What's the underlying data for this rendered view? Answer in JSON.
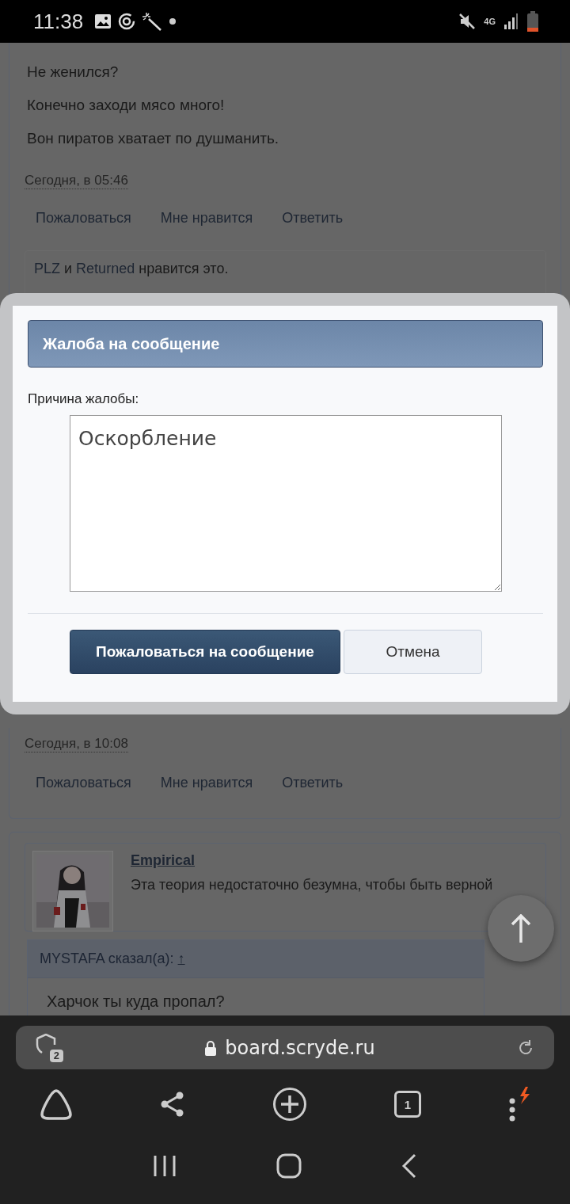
{
  "status_bar": {
    "time": "11:38",
    "network": "4G"
  },
  "post_top": {
    "lines": [
      "Не женился?",
      "Конечно заходи мясо много!",
      "Вон пиратов хватает по душманить."
    ],
    "date": "Сегодня, в 05:46",
    "actions": [
      "Пожаловаться",
      "Мне нравится",
      "Ответить"
    ],
    "likes": {
      "users": [
        "PLZ",
        "Returned"
      ],
      "joiner": "и",
      "suffix": "нравится это."
    }
  },
  "dialog": {
    "title": "Жалоба на сообщение",
    "label": "Причина жалобы:",
    "value": "Оскорбление",
    "buttons": [
      {
        "label": "Пожаловаться на сообщение",
        "kind": "primary"
      },
      {
        "label": "Отмена",
        "kind": "secondary"
      }
    ]
  },
  "post_bottom": {
    "date": "Сегодня, в 10:08",
    "actions": [
      "Пожаловаться",
      "Мне нравится",
      "Ответить"
    ]
  },
  "next_post": {
    "author": "Empirical",
    "signature": "Эта теория недостаточно безумна, чтобы быть верной",
    "quote": {
      "header": "MYSTAFA сказал(а):",
      "jump": "↑",
      "text": "Харчок ты куда пропал?"
    }
  },
  "browser": {
    "url": "board.scryde.ru",
    "tracker_count": "2",
    "tab_count": "1"
  }
}
